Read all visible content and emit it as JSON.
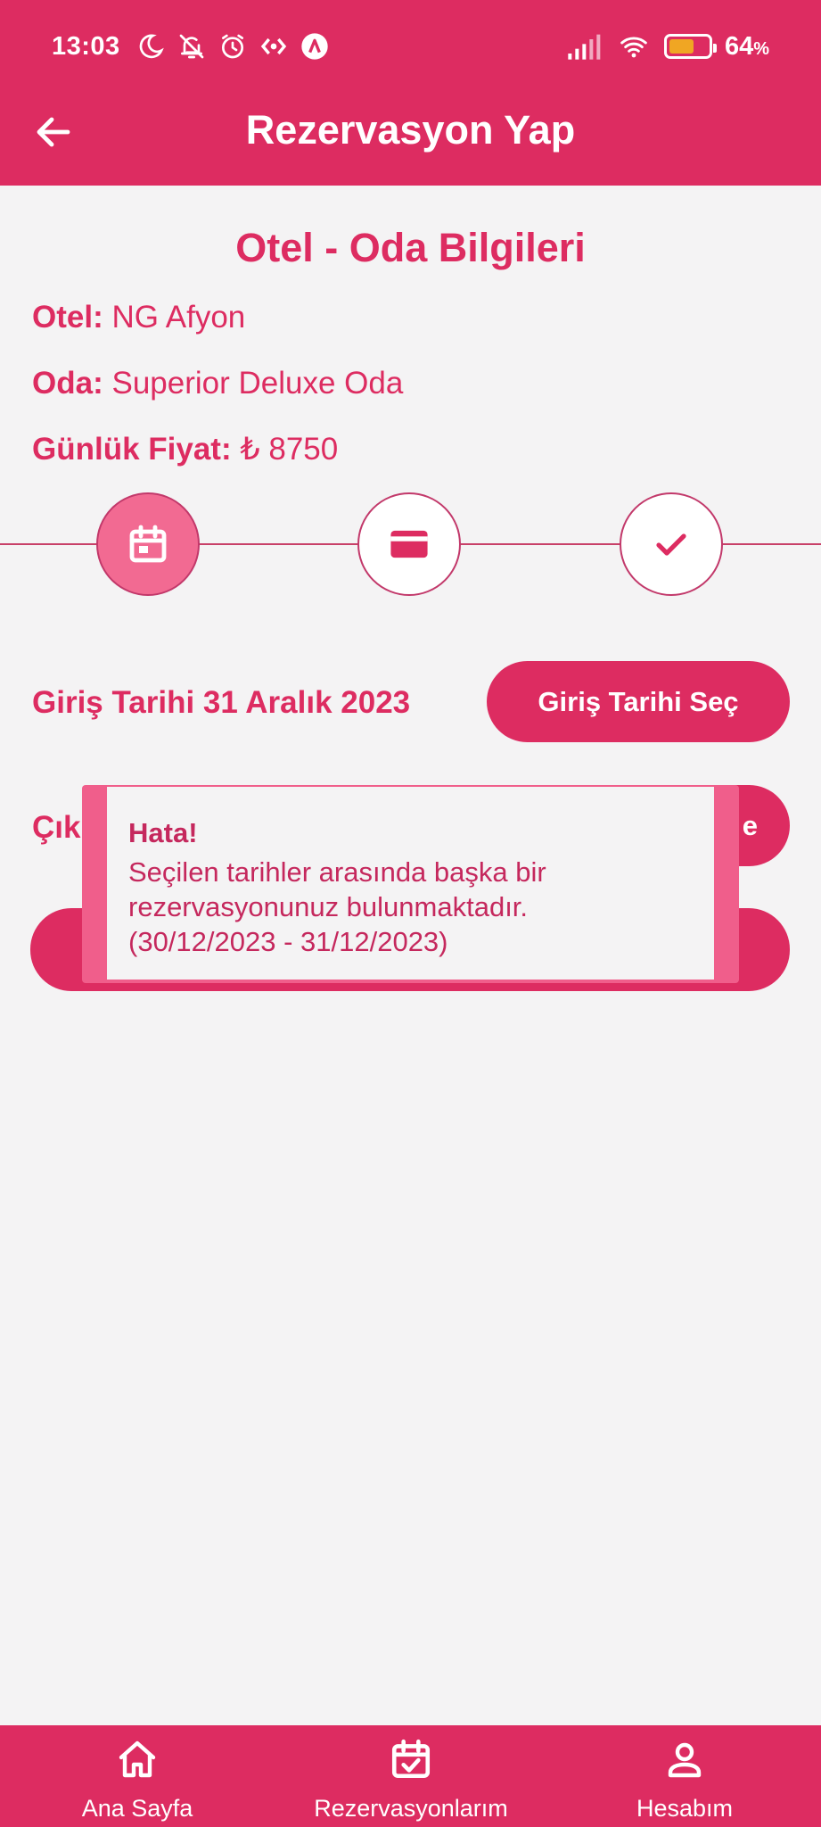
{
  "status_bar": {
    "time": "13:03",
    "battery_percent": "64",
    "battery_suffix": "%",
    "battery_level": 0.64,
    "icons": [
      "moon-icon",
      "bell-off-icon",
      "alarm-icon",
      "data-saver-icon",
      "app-notification-icon",
      "signal-icon",
      "wifi-icon",
      "battery-icon"
    ]
  },
  "toolbar": {
    "title": "Rezervasyon Yap",
    "back_icon": "arrow-left-icon"
  },
  "hotel_info": {
    "section_title": "Otel - Oda Bilgileri",
    "hotel_label": "Otel:",
    "hotel_value": "NG Afyon",
    "room_label": "Oda:",
    "room_value": "Superior Deluxe Oda",
    "price_label": "Günlük Fiyat:",
    "price_value": "₺ 8750"
  },
  "stepper": {
    "active_step": 1,
    "steps": [
      "calendar-icon",
      "credit-card-icon",
      "check-icon"
    ]
  },
  "dates": {
    "checkin_label": "Giriş Tarihi 31 Aralık 2023",
    "checkin_button": "Giriş Tarihi Seç",
    "checkout_label_visible": "Çık",
    "checkout_button_visible": "e"
  },
  "error_dialog": {
    "title": "Hata!",
    "message_line1": "Seçilen tarihler arasında başka bir",
    "message_line2": "rezervasyonunuz bulunmaktadır.",
    "message_line3": "(30/12/2023 - 31/12/2023)"
  },
  "bottom_nav": {
    "items": [
      {
        "label": "Ana Sayfa",
        "icon": "home-icon"
      },
      {
        "label": "Rezervasyonlarım",
        "icon": "calendar-check-icon"
      },
      {
        "label": "Hesabım",
        "icon": "user-icon"
      }
    ]
  },
  "colors": {
    "primary": "#dd2c61",
    "active_step": "#f26a92",
    "background": "#f4f3f4",
    "battery_fill": "#f0a623"
  }
}
